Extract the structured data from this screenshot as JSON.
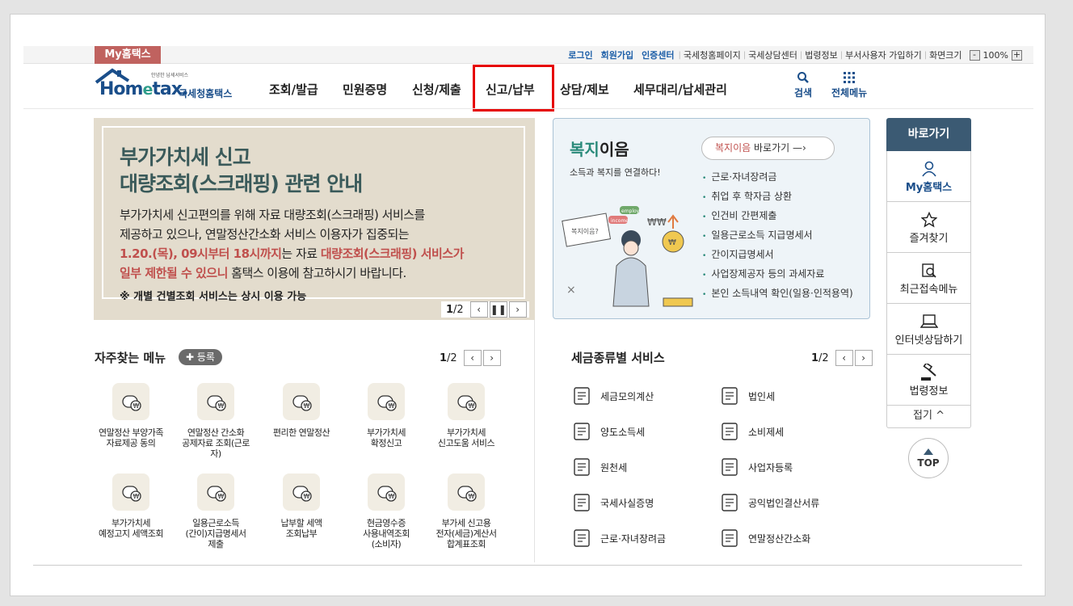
{
  "header": {
    "my_tab": "My홈택스",
    "util_links": [
      "로그인",
      "회원가입",
      "인증센터"
    ],
    "util_links2": [
      "국세청홈페이지",
      "국세상담센터",
      "법령정보",
      "부서사용자 가입하기",
      "화면크기"
    ],
    "zoom_value": "100%",
    "zoom_minus": "-",
    "zoom_plus": "+",
    "logo_tagline": "안녕한 납세서비스",
    "logo_main": "Hometax.",
    "logo_kr": "국세청홈택스",
    "nav": [
      "조회/발급",
      "민원증명",
      "신청/제출",
      "신고/납부",
      "상담/제보",
      "세무대리/납세관리"
    ],
    "tools": [
      {
        "label": "검색",
        "icon": "search-icon"
      },
      {
        "label": "전체메뉴",
        "icon": "grid-menu-icon"
      }
    ]
  },
  "banner": {
    "title1": "부가가치세 신고",
    "title2": "대량조회(스크래핑) 관련 안내",
    "line1": "부가가치세 신고편의를 위해 자료 대량조회(스크래핑) 서비스를",
    "line2": "제공하고 있으나, 연말정산간소화 서비스 이용자가 집중되는",
    "line3_red1": "1.20.(목), 09시부터 18시까지",
    "line3_mid": "는 자료 ",
    "line3_red2": "대량조회(스크래핑) 서비스가",
    "line4_red": "일부 제한될 수 있으니",
    "line4_rest": " 홈택스 이용에 참고하시기 바랍니다.",
    "note_prefix": "※ ",
    "note": "개별 건별조회 서비스는 상시 이용 가능",
    "page_current": "1",
    "page_total": "/2"
  },
  "welfare": {
    "title_green": "복지",
    "title_rest": "이음",
    "subtitle": "소득과 복지를 연결하다!",
    "go_red": "복지이음",
    "go_rest": " 바로가기",
    "items": [
      "근로·자녀장려금",
      "취업 후 학자금 상환",
      "인건비 간편제출",
      "일용근로소득 지급명세서",
      "간이지급명세서",
      "사업장제공자 등의 과세자료",
      "본인 소득내역 확인(일용·인적용역)"
    ],
    "illust_text1": "복지이음?",
    "illust_text2": "income",
    "illust_text3": "employ"
  },
  "quick": {
    "header": "바로가기",
    "items": [
      {
        "label": "My홈택스",
        "icon": "user-icon"
      },
      {
        "label": "즐겨찾기",
        "icon": "star-icon"
      },
      {
        "label": "최근접속메뉴",
        "icon": "recent-menu-icon"
      },
      {
        "label": "인터넷상담하기",
        "icon": "laptop-icon"
      },
      {
        "label": "법령정보",
        "icon": "gavel-icon"
      }
    ],
    "fold": "접기 ^",
    "top": "TOP"
  },
  "favorites": {
    "title": "자주찾는 메뉴",
    "register": "등록",
    "page_current": "1",
    "page_total": "/2",
    "items": [
      [
        "연말정산 부양가족",
        "자료제공 동의",
        ""
      ],
      [
        "연말정산 간소화",
        "공제자료 조회(근로",
        "자)"
      ],
      [
        "편리한 연말정산",
        "",
        ""
      ],
      [
        "부가가치세",
        "확정신고",
        ""
      ],
      [
        "부가가치세",
        "신고도움 서비스",
        ""
      ],
      [
        "부가가치세",
        "예정고지 세액조회",
        ""
      ],
      [
        "일용근로소득",
        "(간이)지급명세서",
        "제출"
      ],
      [
        "납부할 세액",
        "조회납부",
        ""
      ],
      [
        "현금영수증",
        "사용내역조회",
        "(소비자)"
      ],
      [
        "부가세 신고용",
        "전자(세금)계산서",
        "합계표조회"
      ]
    ]
  },
  "taxes": {
    "title": "세금종류별 서비스",
    "page_current": "1",
    "page_total": "/2",
    "items": [
      "세금모의계산",
      "법인세",
      "양도소득세",
      "소비제세",
      "원천세",
      "사업자등록",
      "국세사실증명",
      "공익법인결산서류",
      "근로·자녀장려금",
      "연말정산간소화"
    ]
  },
  "colors": {
    "accent": "#1a4e8a",
    "my_tab": "#c0625f",
    "highlight": "#e60000",
    "quick_header": "#3b5a73"
  }
}
